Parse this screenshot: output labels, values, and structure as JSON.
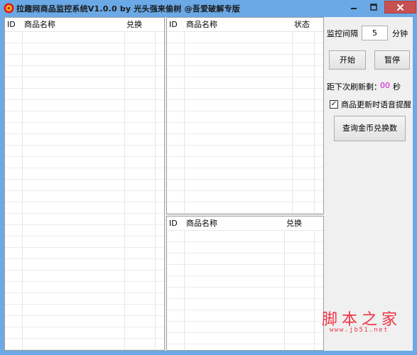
{
  "window": {
    "title": "拉趣网商品监控系统V1.0.0  by 光头强来偷树 @吾爱破解专版",
    "controls": {
      "minimize_icon": "minimize-icon",
      "maximize_icon": "maximize-icon",
      "close_icon": "close-icon"
    }
  },
  "grids": {
    "left": {
      "columns": [
        "ID",
        "商品名称",
        "兑换"
      ]
    },
    "top_right": {
      "columns": [
        "ID",
        "商品名称",
        "状态"
      ]
    },
    "bottom_right": {
      "columns": [
        "ID",
        "商品名称",
        "兑换"
      ]
    }
  },
  "panel": {
    "interval_label": "监控间隔",
    "interval_value": "5",
    "interval_unit": "分钟",
    "start_button": "开始",
    "pause_button": "暂停",
    "countdown_label": "距下次刷新剩：",
    "countdown_value": "00",
    "countdown_unit": "秒",
    "voice_alert_label": "商品更新时语音提醒",
    "voice_alert_checked": true,
    "query_button": "查询金币兑换数"
  },
  "watermark": {
    "chars": "脚本之家",
    "url": "www.jb51.net"
  },
  "colors": {
    "title_bar": "#6aa8e6",
    "close_button": "#c75050",
    "countdown_value": "#d014d0",
    "watermark": "#ee3344"
  }
}
